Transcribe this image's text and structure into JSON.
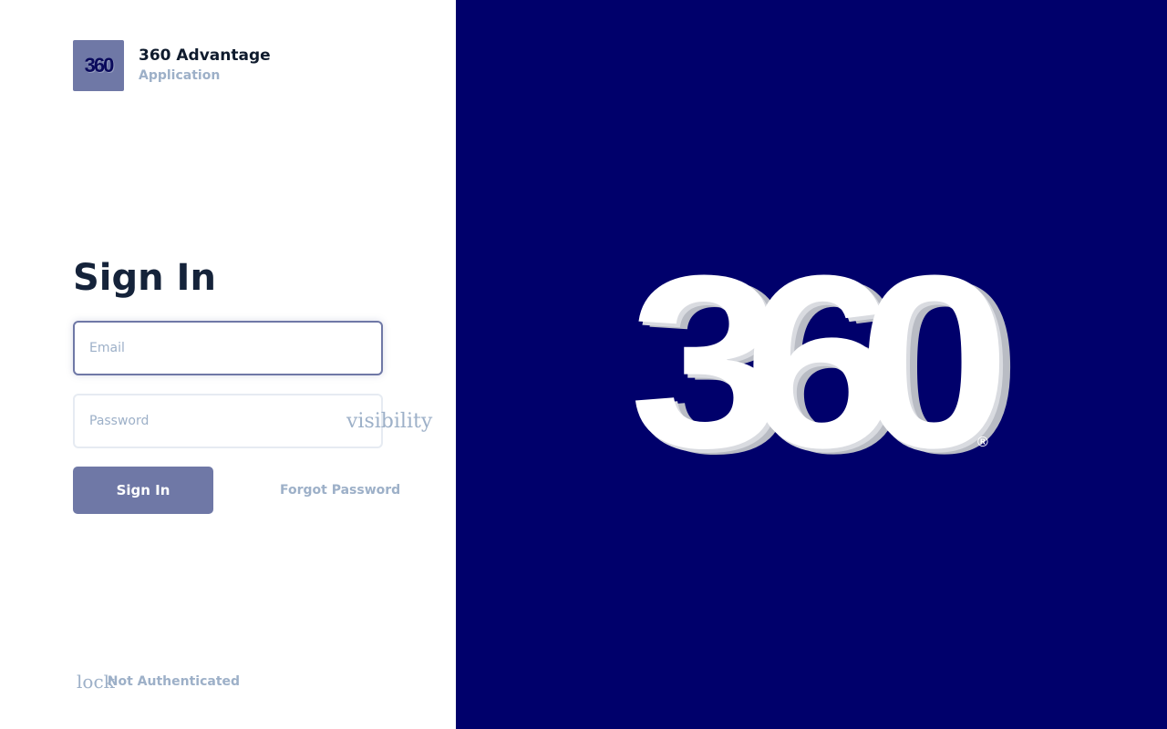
{
  "brand": {
    "logo_text": "360",
    "title": "360 Advantage",
    "subtitle": "Application"
  },
  "signin": {
    "heading": "Sign In",
    "email_placeholder": "Email",
    "email_value": "",
    "password_placeholder": "Password",
    "password_value": "",
    "visibility_icon": "visibility",
    "button_label": "Sign In",
    "forgot_label": "Forgot Password"
  },
  "status": {
    "lock_icon": "lock",
    "label": "Not Authenticated"
  },
  "hero": {
    "logo_text": "360",
    "registered_mark": "®"
  },
  "colors": {
    "brand_navy": "#00006b",
    "accent": "#6f78a6",
    "muted_text": "#9db0c8",
    "heading": "#15233a"
  }
}
